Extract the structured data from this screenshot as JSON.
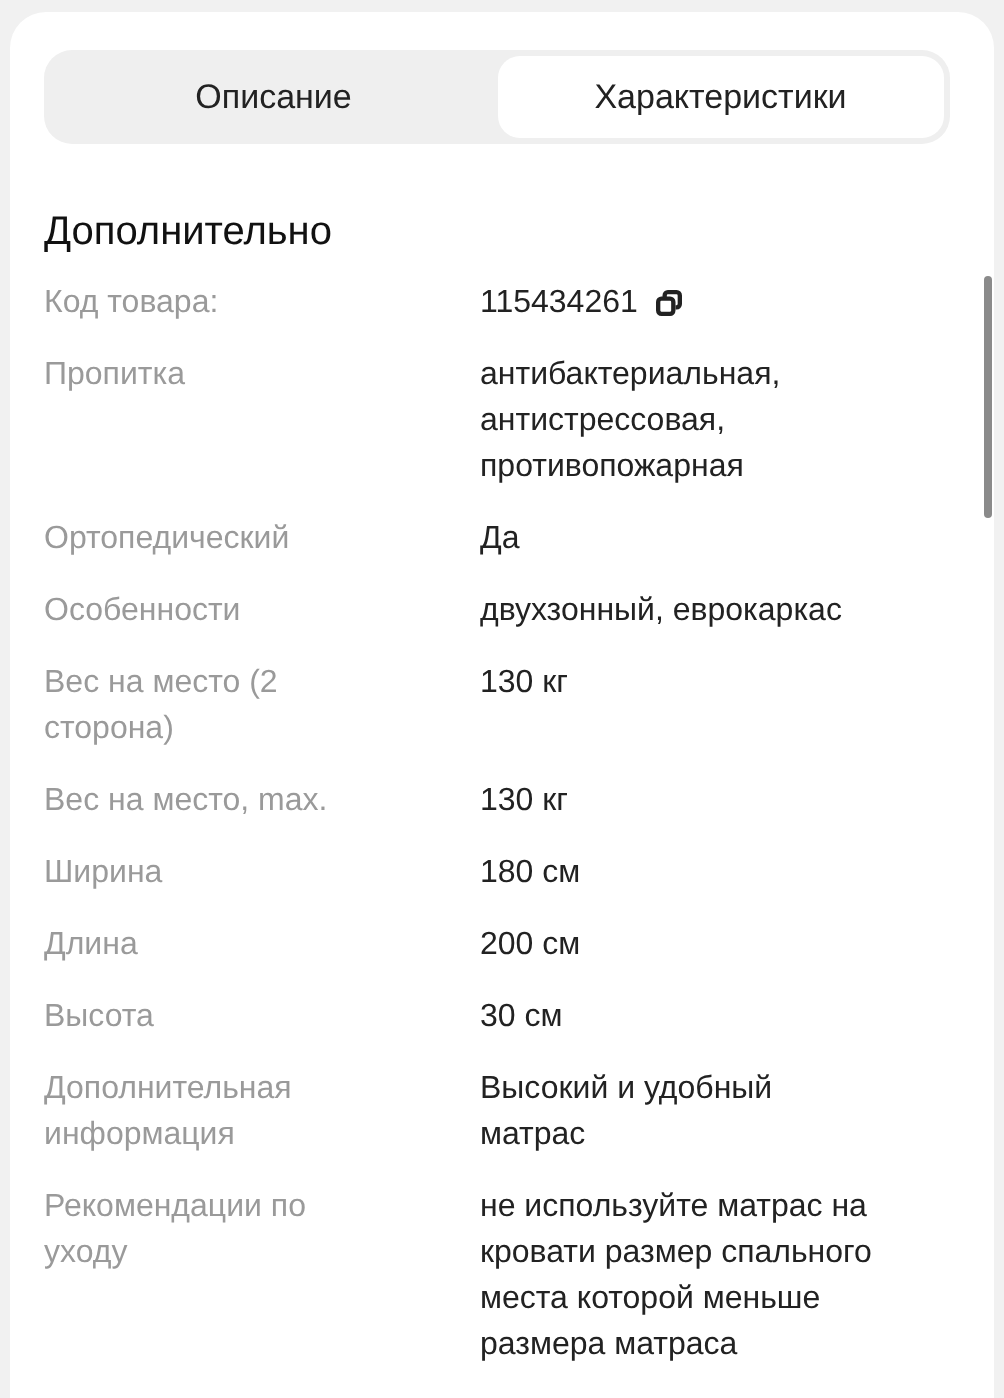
{
  "tabs": [
    {
      "label": "Описание",
      "selected": false
    },
    {
      "label": "Характеристики",
      "selected": true
    }
  ],
  "section": {
    "title": "Дополнительно",
    "rows": [
      {
        "label": "Код товара:",
        "value": "115434261",
        "copyable": true
      },
      {
        "label": "Пропитка",
        "value": "антибактериальная,\nантистрессовая,\nпротивопожарная"
      },
      {
        "label": "Ортопедический",
        "value": "Да"
      },
      {
        "label": "Особенности",
        "value": "двухзонный, еврокаркас"
      },
      {
        "label": "Вес на место (2\nсторона)",
        "value": "130 кг"
      },
      {
        "label": "Вес на место, max.",
        "value": "130 кг"
      },
      {
        "label": "Ширина",
        "value": "180 см"
      },
      {
        "label": "Длина",
        "value": "200 см"
      },
      {
        "label": "Высота",
        "value": "30 см"
      },
      {
        "label": "Дополнительная\nинформация",
        "value": "Высокий и удобный\nматрас"
      },
      {
        "label": "Рекомендации по\nуходу",
        "value": "не используйте матрас на\nкровати размер спального\nместа которой меньше\nразмера матраса"
      }
    ]
  }
}
